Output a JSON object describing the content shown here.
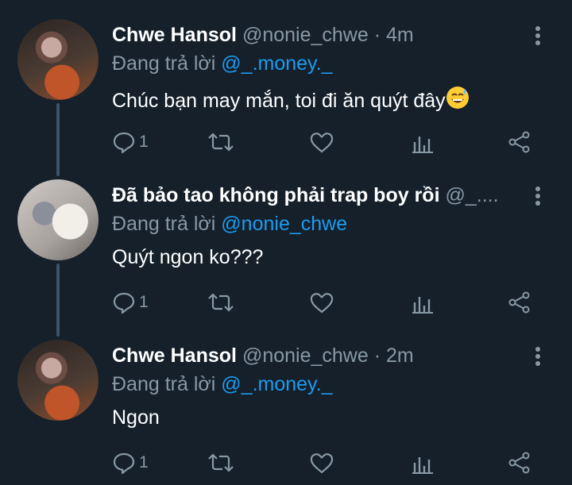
{
  "tweets": [
    {
      "name": "Chwe Hansol",
      "handle": "@nonie_chwe",
      "separator": "·",
      "time": "4m",
      "reply_prefix": "Đang trả lời",
      "reply_to": "@_.money._",
      "text": "Chúc bạn may mắn, toi đi ăn quýt đây",
      "emoji": "grinning-sweat-emoji",
      "reply_count": "1"
    },
    {
      "name": "Đã bảo tao không phải trap boy rồi",
      "handle": "@_....",
      "separator": "",
      "time": "",
      "reply_prefix": "Đang trả lời",
      "reply_to": "@nonie_chwe",
      "text": "Quýt ngon ko???",
      "reply_count": "1"
    },
    {
      "name": "Chwe Hansol",
      "handle": "@nonie_chwe",
      "separator": "·",
      "time": "2m",
      "reply_prefix": "Đang trả lời",
      "reply_to": "@_.money._",
      "text": "Ngon",
      "reply_count": "1"
    }
  ],
  "icons": {
    "more": "more-vertical-icon",
    "reply": "reply-icon",
    "retweet": "retweet-icon",
    "like": "heart-icon",
    "analytics": "analytics-icon",
    "share": "share-icon"
  },
  "colors": {
    "background": "#15202b",
    "secondary_text": "#8899a6",
    "link": "#1d9bf0",
    "thread_line": "#3d5466"
  }
}
